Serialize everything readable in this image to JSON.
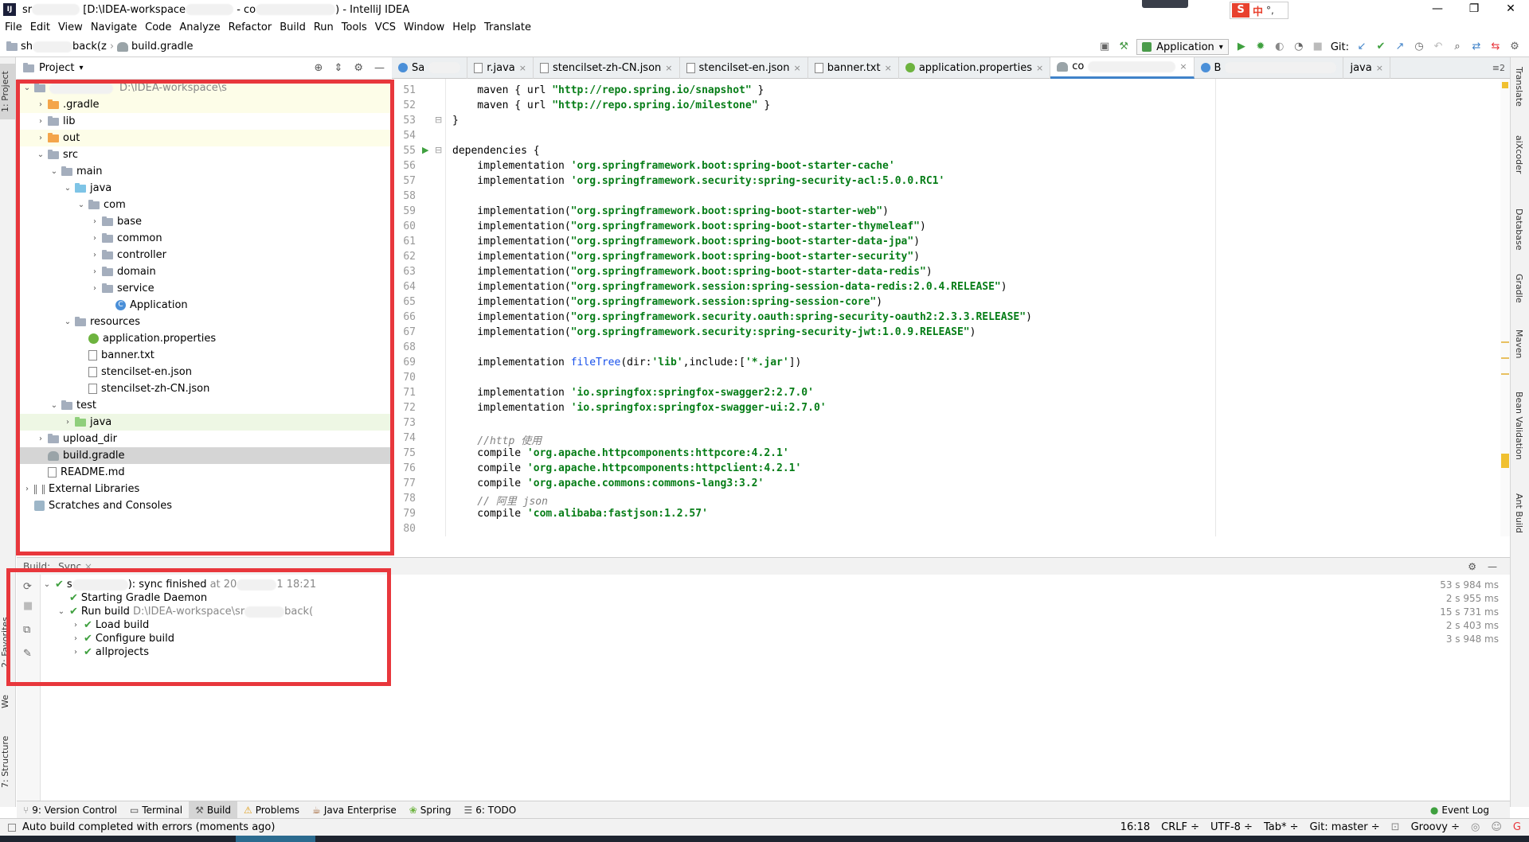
{
  "window": {
    "title_prefix": "sr",
    "title_path": "[D:\\IDEA-workspace",
    "title_mid": "- co",
    "title_suffix": ") - IntelliJ IDEA",
    "controls": [
      "—",
      "❐",
      "✕"
    ],
    "ime": {
      "logo": "S",
      "mode": "中",
      "punct": "°,"
    }
  },
  "menu": [
    "File",
    "Edit",
    "View",
    "Navigate",
    "Code",
    "Analyze",
    "Refactor",
    "Build",
    "Run",
    "Tools",
    "VCS",
    "Window",
    "Help",
    "Translate"
  ],
  "navbar": {
    "project_crumb": "sh",
    "project_crumb_tail": "back(z",
    "file_crumb": "build.gradle",
    "run_config": "Application",
    "git_label": "Git:"
  },
  "project_panel": {
    "title": "Project",
    "strip_tab": "1: Project",
    "root_path": "D:\\IDEA-workspace\\s",
    "tree": [
      {
        "label": "",
        "depth": 0,
        "arrow": "⌄",
        "icon": "folder",
        "muted": "D:\\IDEA-workspace\\s",
        "bg": "yellow"
      },
      {
        "label": ".gradle",
        "depth": 1,
        "arrow": "›",
        "icon": "folder-orange",
        "bg": "yellow"
      },
      {
        "label": "lib",
        "depth": 1,
        "arrow": "›",
        "icon": "folder",
        "bg": ""
      },
      {
        "label": "out",
        "depth": 1,
        "arrow": "›",
        "icon": "folder-orange",
        "bg": "yellow"
      },
      {
        "label": "src",
        "depth": 1,
        "arrow": "⌄",
        "icon": "folder",
        "bg": ""
      },
      {
        "label": "main",
        "depth": 2,
        "arrow": "⌄",
        "icon": "folder",
        "bg": ""
      },
      {
        "label": "java",
        "depth": 3,
        "arrow": "⌄",
        "icon": "folder-blue",
        "bg": ""
      },
      {
        "label": "com",
        "depth": 4,
        "arrow": "⌄",
        "icon": "folder",
        "bg": ""
      },
      {
        "label": "base",
        "depth": 5,
        "arrow": "›",
        "icon": "folder",
        "bg": ""
      },
      {
        "label": "common",
        "depth": 5,
        "arrow": "›",
        "icon": "folder",
        "bg": ""
      },
      {
        "label": "controller",
        "depth": 5,
        "arrow": "›",
        "icon": "folder",
        "bg": ""
      },
      {
        "label": "domain",
        "depth": 5,
        "arrow": "›",
        "icon": "folder",
        "bg": ""
      },
      {
        "label": "service",
        "depth": 5,
        "arrow": "›",
        "icon": "folder",
        "bg": ""
      },
      {
        "label": "Application",
        "depth": 6,
        "arrow": "",
        "icon": "class",
        "bg": ""
      },
      {
        "label": "resources",
        "depth": 3,
        "arrow": "⌄",
        "icon": "folder",
        "bg": ""
      },
      {
        "label": "application.properties",
        "depth": 4,
        "arrow": "",
        "icon": "spring",
        "bg": ""
      },
      {
        "label": "banner.txt",
        "depth": 4,
        "arrow": "",
        "icon": "file",
        "bg": ""
      },
      {
        "label": "stencilset-en.json",
        "depth": 4,
        "arrow": "",
        "icon": "file",
        "bg": ""
      },
      {
        "label": "stencilset-zh-CN.json",
        "depth": 4,
        "arrow": "",
        "icon": "file",
        "bg": ""
      },
      {
        "label": "test",
        "depth": 2,
        "arrow": "⌄",
        "icon": "folder",
        "bg": ""
      },
      {
        "label": "java",
        "depth": 3,
        "arrow": "›",
        "icon": "folder-green",
        "bg": "green"
      },
      {
        "label": "upload_dir",
        "depth": 1,
        "arrow": "›",
        "icon": "folder",
        "bg": ""
      },
      {
        "label": "build.gradle",
        "depth": 1,
        "arrow": "",
        "icon": "gradle",
        "bg": "selected"
      },
      {
        "label": "README.md",
        "depth": 1,
        "arrow": "",
        "icon": "file",
        "bg": ""
      },
      {
        "label": "External Libraries",
        "depth": 0,
        "arrow": "›",
        "icon": "lib",
        "bg": ""
      },
      {
        "label": "Scratches and Consoles",
        "depth": 0,
        "arrow": "",
        "icon": "scratch",
        "bg": ""
      }
    ]
  },
  "editor_tabs": [
    {
      "label": "Sa",
      "icon": "class",
      "closable": false,
      "active": false
    },
    {
      "label": "r.java",
      "icon": "java",
      "closable": true,
      "active": false
    },
    {
      "label": "stencilset-zh-CN.json",
      "icon": "java",
      "closable": true,
      "active": false
    },
    {
      "label": "stencilset-en.json",
      "icon": "java",
      "closable": true,
      "active": false
    },
    {
      "label": "banner.txt",
      "icon": "java",
      "closable": true,
      "active": false
    },
    {
      "label": "application.properties",
      "icon": "spring",
      "closable": true,
      "active": false
    },
    {
      "label": "co",
      "icon": "gradle",
      "closable": true,
      "active": true
    },
    {
      "label": "B",
      "icon": "class",
      "closable": false,
      "active": false
    },
    {
      "label": "java",
      "icon": "none",
      "closable": true,
      "active": false
    }
  ],
  "editor_tabs_overflow": "≡2",
  "code_lines": [
    {
      "n": "51",
      "segments": [
        {
          "t": "    maven { url ",
          "c": ""
        },
        {
          "t": "\"http://repo.spring.io/snapshot\"",
          "c": "str"
        },
        {
          "t": " }",
          "c": ""
        }
      ]
    },
    {
      "n": "52",
      "segments": [
        {
          "t": "    maven { url ",
          "c": ""
        },
        {
          "t": "\"http://repo.spring.io/milestone\"",
          "c": "str"
        },
        {
          "t": " }",
          "c": ""
        }
      ]
    },
    {
      "n": "53",
      "segments": [
        {
          "t": "}",
          "c": ""
        }
      ]
    },
    {
      "n": "54",
      "segments": []
    },
    {
      "n": "55",
      "segments": [
        {
          "t": "dependencies {",
          "c": ""
        }
      ]
    },
    {
      "n": "56",
      "segments": [
        {
          "t": "    implementation ",
          "c": ""
        },
        {
          "t": "'org.springframework.boot:spring-boot-starter-cache'",
          "c": "str"
        }
      ]
    },
    {
      "n": "57",
      "segments": [
        {
          "t": "    implementation ",
          "c": ""
        },
        {
          "t": "'org.springframework.security:spring-security-acl:5.0.0.RC1'",
          "c": "str"
        }
      ]
    },
    {
      "n": "58",
      "segments": []
    },
    {
      "n": "59",
      "segments": [
        {
          "t": "    implementation(",
          "c": ""
        },
        {
          "t": "\"org.springframework.boot:spring-boot-starter-web\"",
          "c": "str"
        },
        {
          "t": ")",
          "c": ""
        }
      ]
    },
    {
      "n": "60",
      "segments": [
        {
          "t": "    implementation(",
          "c": ""
        },
        {
          "t": "\"org.springframework.boot:spring-boot-starter-thymeleaf\"",
          "c": "str"
        },
        {
          "t": ")",
          "c": ""
        }
      ]
    },
    {
      "n": "61",
      "segments": [
        {
          "t": "    implementation(",
          "c": ""
        },
        {
          "t": "\"org.springframework.boot:spring-boot-starter-data-jpa\"",
          "c": "str"
        },
        {
          "t": ")",
          "c": ""
        }
      ]
    },
    {
      "n": "62",
      "segments": [
        {
          "t": "    implementation(",
          "c": ""
        },
        {
          "t": "\"org.springframework.boot:spring-boot-starter-security\"",
          "c": "str"
        },
        {
          "t": ")",
          "c": ""
        }
      ]
    },
    {
      "n": "63",
      "segments": [
        {
          "t": "    implementation(",
          "c": ""
        },
        {
          "t": "\"org.springframework.boot:spring-boot-starter-data-redis\"",
          "c": "str"
        },
        {
          "t": ")",
          "c": ""
        }
      ]
    },
    {
      "n": "64",
      "segments": [
        {
          "t": "    implementation(",
          "c": ""
        },
        {
          "t": "\"org.springframework.session:spring-session-data-redis:2.0.4.RELEASE\"",
          "c": "str"
        },
        {
          "t": ")",
          "c": ""
        }
      ]
    },
    {
      "n": "65",
      "segments": [
        {
          "t": "    implementation(",
          "c": ""
        },
        {
          "t": "\"org.springframework.session:spring-session-core\"",
          "c": "str"
        },
        {
          "t": ")",
          "c": ""
        }
      ]
    },
    {
      "n": "66",
      "segments": [
        {
          "t": "    implementation(",
          "c": ""
        },
        {
          "t": "\"org.springframework.security.oauth:spring-security-oauth2:2.3.3.RELEASE\"",
          "c": "str"
        },
        {
          "t": ")",
          "c": ""
        }
      ]
    },
    {
      "n": "67",
      "segments": [
        {
          "t": "    implementation(",
          "c": ""
        },
        {
          "t": "\"org.springframework.security:spring-security-jwt:1.0.9.RELEASE\"",
          "c": "str"
        },
        {
          "t": ")",
          "c": ""
        }
      ]
    },
    {
      "n": "68",
      "segments": []
    },
    {
      "n": "69",
      "segments": [
        {
          "t": "    implementation ",
          "c": ""
        },
        {
          "t": "fileTree",
          "c": "fn"
        },
        {
          "t": "(dir:",
          "c": ""
        },
        {
          "t": "'lib'",
          "c": "str"
        },
        {
          "t": ",include:[",
          "c": ""
        },
        {
          "t": "'*.jar'",
          "c": "str"
        },
        {
          "t": "])",
          "c": ""
        }
      ]
    },
    {
      "n": "70",
      "segments": []
    },
    {
      "n": "71",
      "segments": [
        {
          "t": "    implementation ",
          "c": ""
        },
        {
          "t": "'io.springfox:springfox-swagger2:2.7.0'",
          "c": "str"
        }
      ]
    },
    {
      "n": "72",
      "segments": [
        {
          "t": "    implementation ",
          "c": ""
        },
        {
          "t": "'io.springfox:springfox-swagger-ui:2.7.0'",
          "c": "str"
        }
      ]
    },
    {
      "n": "73",
      "segments": []
    },
    {
      "n": "74",
      "segments": [
        {
          "t": "    //http 使用",
          "c": "cm"
        }
      ]
    },
    {
      "n": "75",
      "segments": [
        {
          "t": "    compile ",
          "c": ""
        },
        {
          "t": "'org.apache.httpcomponents:httpcore:4.2.1'",
          "c": "str"
        }
      ]
    },
    {
      "n": "76",
      "segments": [
        {
          "t": "    compile ",
          "c": ""
        },
        {
          "t": "'org.apache.httpcomponents:httpclient:4.2.1'",
          "c": "str"
        }
      ]
    },
    {
      "n": "77",
      "segments": [
        {
          "t": "    compile ",
          "c": ""
        },
        {
          "t": "'org.apache.commons:commons-lang3:3.2'",
          "c": "str"
        }
      ]
    },
    {
      "n": "78",
      "segments": [
        {
          "t": "    // 阿里 json",
          "c": "cm"
        }
      ]
    },
    {
      "n": "79",
      "segments": [
        {
          "t": "    compile ",
          "c": ""
        },
        {
          "t": "'com.alibaba:fastjson:1.2.57'",
          "c": "str"
        }
      ]
    },
    {
      "n": "80",
      "segments": []
    }
  ],
  "build_panel": {
    "label": "Build:",
    "tab": "Sync",
    "rows": [
      {
        "depth": 0,
        "arrow": "⌄",
        "label": "s",
        "label_tail": "): sync finished",
        "muted": "at 20",
        "muted_tail": "1 18:21",
        "time": "53 s 984 ms"
      },
      {
        "depth": 1,
        "arrow": "",
        "label": "Starting Gradle Daemon",
        "label_tail": "",
        "muted": "",
        "muted_tail": "",
        "time": "2 s 955 ms"
      },
      {
        "depth": 1,
        "arrow": "⌄",
        "label": "Run build",
        "label_tail": "",
        "muted": "D:\\IDEA-workspace\\sr",
        "muted_tail": "back(",
        "time": "15 s 731 ms"
      },
      {
        "depth": 2,
        "arrow": "›",
        "label": "Load build",
        "label_tail": "",
        "muted": "",
        "muted_tail": "",
        "time": "2 s 403 ms"
      },
      {
        "depth": 2,
        "arrow": "›",
        "label": "Configure build",
        "label_tail": "",
        "muted": "",
        "muted_tail": "",
        "time": "3 s 948 ms"
      },
      {
        "depth": 2,
        "arrow": "›",
        "label": "allprojects",
        "label_tail": "",
        "muted": "",
        "muted_tail": "",
        "time": ""
      }
    ]
  },
  "left_strip_tabs": [
    "1: Project",
    "2: Favorites",
    "We",
    "7: Structure"
  ],
  "right_strip_tabs": [
    "Translate",
    "aiXcoder",
    "Database",
    "Gradle",
    "Maven",
    "Bean Validation",
    "Ant Build"
  ],
  "bottom_tools": [
    {
      "label": "9: Version Control",
      "active": false
    },
    {
      "label": "Terminal",
      "active": false
    },
    {
      "label": "Build",
      "active": true
    },
    {
      "label": "Problems",
      "active": false
    },
    {
      "label": "Java Enterprise",
      "active": false
    },
    {
      "label": "Spring",
      "active": false
    },
    {
      "label": "6: TODO",
      "active": false
    }
  ],
  "event_log": "Event Log",
  "status": {
    "message": "Auto build completed with errors (moments ago)",
    "position": "16:18",
    "line_sep": "CRLF ÷",
    "encoding": "UTF-8 ÷",
    "indent": "Tab* ÷",
    "git": "Git: master ÷",
    "lang": "Groovy ÷"
  },
  "colors": {
    "accent": "#4083c9",
    "annotation": "#e8373c",
    "check": "#3fa03f"
  }
}
